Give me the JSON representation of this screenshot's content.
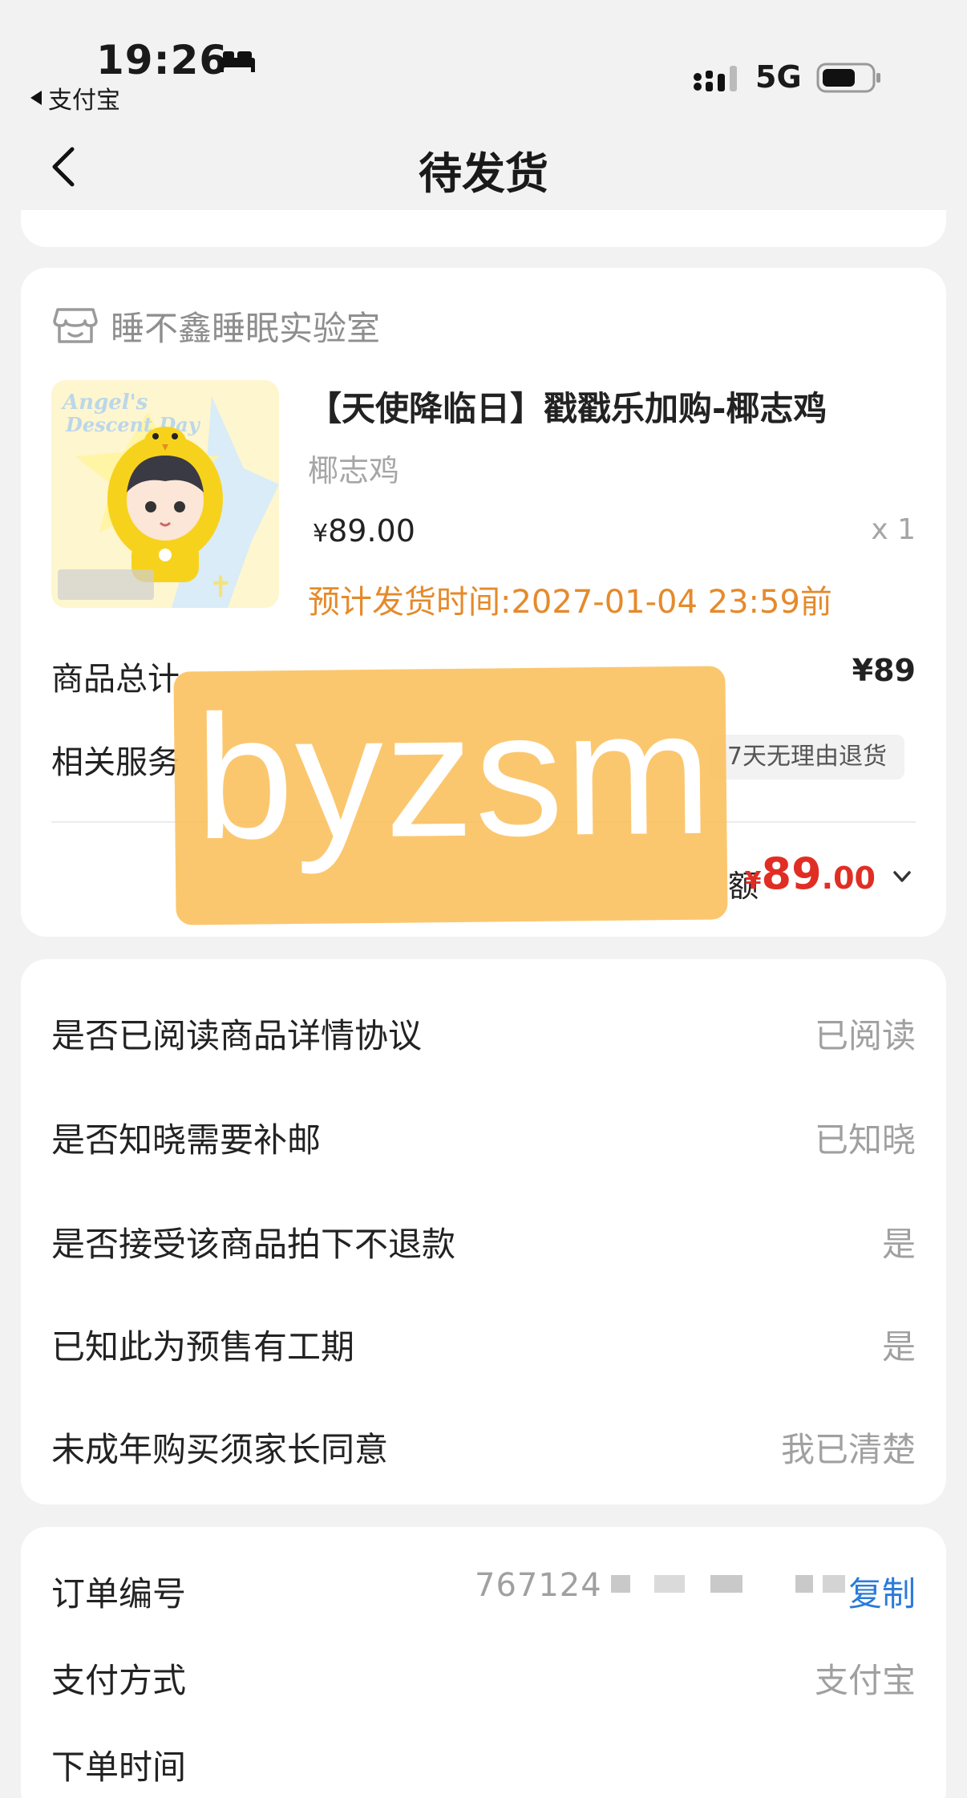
{
  "status_bar": {
    "time": "19:26",
    "back_app": "支付宝",
    "network": "5G"
  },
  "nav": {
    "title": "待发货"
  },
  "shop": {
    "name": "睡不鑫睡眠实验室"
  },
  "product": {
    "title": "【天使降临日】戳戳乐加购-椰志鸡",
    "spec": "椰志鸡",
    "price_symbol": "¥",
    "price": "89.00",
    "quantity": "x 1",
    "ship_time": "预计发货时间:2027-01-04 23:59前",
    "image_caption": "Angel's Descent Day"
  },
  "summary": {
    "total_label": "商品总计",
    "total_value": "¥89",
    "service_label": "相关服务",
    "service_tag": "7天无理由退货",
    "pay_label": "额",
    "pay_symbol": "¥",
    "pay_int": "89",
    "pay_dec": ".00"
  },
  "watermark": "byzsm",
  "agreements": [
    {
      "question": "是否已阅读商品详情协议",
      "answer": "已阅读"
    },
    {
      "question": "是否知晓需要补邮",
      "answer": "已知晓"
    },
    {
      "question": "是否接受该商品拍下不退款",
      "answer": "是"
    },
    {
      "question": "已知此为预售有工期",
      "answer": "是"
    },
    {
      "question": "未成年购买须家长同意",
      "answer": "我已清楚"
    }
  ],
  "order_info": {
    "order_no_label": "订单编号",
    "order_no_value": "767124",
    "copy_label": "复制",
    "pay_method_label": "支付方式",
    "pay_method_value": "支付宝",
    "order_time_label": "下单时间"
  },
  "colors": {
    "accent_orange": "#e58a2b",
    "price_red": "#e02e24",
    "link_blue": "#2b7bd9",
    "watermark": "#fbc15e"
  }
}
